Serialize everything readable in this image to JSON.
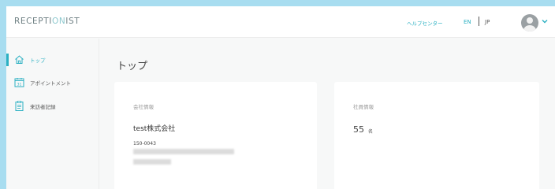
{
  "header": {
    "brand_main": "RECEPTI",
    "brand_accent": "ON",
    "brand_tail": "IST",
    "help_link": "ヘルプセンター",
    "lang_en": "EN",
    "lang_jp": "JP"
  },
  "sidebar": {
    "items": [
      {
        "label": "トップ",
        "icon": "home-icon",
        "active": true
      },
      {
        "label": "アポイントメント",
        "icon": "calendar-icon",
        "active": false
      },
      {
        "label": "来訪者記録",
        "icon": "clipboard-icon",
        "active": false
      }
    ]
  },
  "main": {
    "page_title": "トップ",
    "company_card": {
      "label": "会社情報",
      "company_name": "test株式会社",
      "postal_code": "150-0043"
    },
    "staff_card": {
      "label": "社員情報",
      "count": "55",
      "unit": "名"
    }
  },
  "colors": {
    "accent": "#2bb0c2",
    "frame": "#a8ddf0",
    "surface": "#ffffff",
    "background": "#f7f8f8"
  }
}
